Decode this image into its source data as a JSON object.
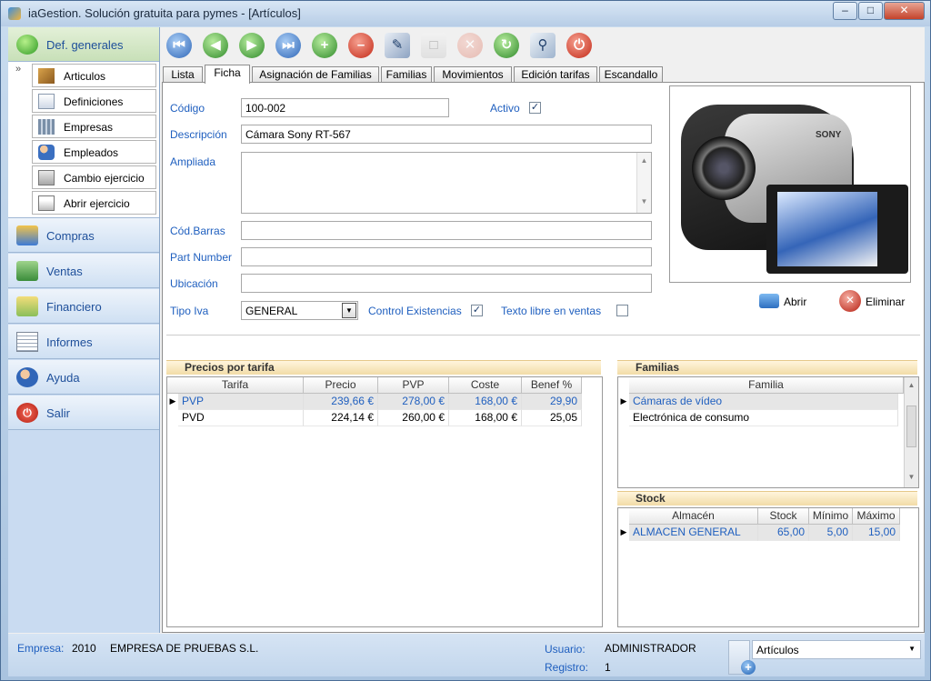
{
  "window": {
    "title": "iaGestion. Solución gratuita para pymes - [Artículos]",
    "minimize": "0",
    "maximize": "1",
    "close": "r"
  },
  "sidebar": {
    "sections": [
      {
        "label": "Def. generales",
        "icon": "green-circle-icon"
      },
      {
        "label": "Compras",
        "icon": "truck-icon"
      },
      {
        "label": "Ventas",
        "icon": "cash-icon"
      },
      {
        "label": "Financiero",
        "icon": "coins-icon"
      },
      {
        "label": "Informes",
        "icon": "report-icon"
      },
      {
        "label": "Ayuda",
        "icon": "help-person-icon"
      },
      {
        "label": "Salir",
        "icon": "power-icon"
      }
    ],
    "subitems": [
      {
        "label": "Articulos",
        "icon": "boxes-icon"
      },
      {
        "label": "Definiciones",
        "icon": "document-icon"
      },
      {
        "label": "Empresas",
        "icon": "buildings-icon"
      },
      {
        "label": "Empleados",
        "icon": "people-icon"
      },
      {
        "label": "Cambio ejercicio",
        "icon": "calendar-change-icon"
      },
      {
        "label": "Abrir ejercicio",
        "icon": "calendar-icon"
      }
    ]
  },
  "toolbar": {
    "buttons": [
      "first-record-icon",
      "previous-record-icon",
      "next-record-icon",
      "last-record-icon",
      "add-icon",
      "delete-icon",
      "edit-icon",
      "save-icon",
      "cancel-icon",
      "refresh-icon",
      "search-icon",
      "exit-icon"
    ]
  },
  "tabs": [
    "Lista",
    "Ficha",
    "Asignación de Familias",
    "Familias",
    "Movimientos",
    "Edición tarifas",
    "Escandallo"
  ],
  "form": {
    "codigo_label": "Código",
    "codigo": "100-002",
    "activo_label": "Activo",
    "activo": true,
    "descripcion_label": "Descripción",
    "descripcion": "Cámara Sony RT-567",
    "ampliada_label": "Ampliada",
    "ampliada": "",
    "codbarras_label": "Cód.Barras",
    "codbarras": "",
    "partnumber_label": "Part Number",
    "partnumber": "",
    "ubicacion_label": "Ubicación",
    "ubicacion": "",
    "tipoiva_label": "Tipo Iva",
    "tipoiva": "GENERAL",
    "control_label": "Control Existencias",
    "control": true,
    "textolibre_label": "Texto libre en ventas",
    "textolibre": false
  },
  "image_actions": {
    "abrir": "Abrir",
    "eliminar": "Eliminar"
  },
  "camera_brand": "SONY",
  "precios": {
    "title": "Precios por tarifa",
    "headers": [
      "Tarifa",
      "Precio",
      "PVP",
      "Coste",
      "Benef %"
    ],
    "rows": [
      [
        "PVP",
        "239,66 €",
        "278,00 €",
        "168,00 €",
        "29,90"
      ],
      [
        "PVD",
        "224,14 €",
        "260,00 €",
        "168,00 €",
        "25,05"
      ]
    ]
  },
  "familias": {
    "title": "Familias",
    "headers": [
      "Familia"
    ],
    "rows": [
      [
        "Cámaras de vídeo"
      ],
      [
        "Electrónica de consumo"
      ]
    ]
  },
  "stock": {
    "title": "Stock",
    "headers": [
      "Almacén",
      "Stock",
      "Mínimo",
      "Máximo"
    ],
    "rows": [
      [
        "ALMACEN GENERAL",
        "65,00",
        "5,00",
        "15,00"
      ]
    ]
  },
  "status": {
    "empresa_label": "Empresa:",
    "empresa_year": "2010",
    "empresa_name": "EMPRESA DE PRUEBAS S.L.",
    "usuario_label": "Usuario:",
    "usuario": "ADMINISTRADOR",
    "registro_label": "Registro:",
    "registro": "1",
    "modulo": "Artículos"
  },
  "colors": {
    "label_blue": "#1f5fbf",
    "accent_red": "#d22b1f",
    "accent_green": "#3aa63a"
  }
}
